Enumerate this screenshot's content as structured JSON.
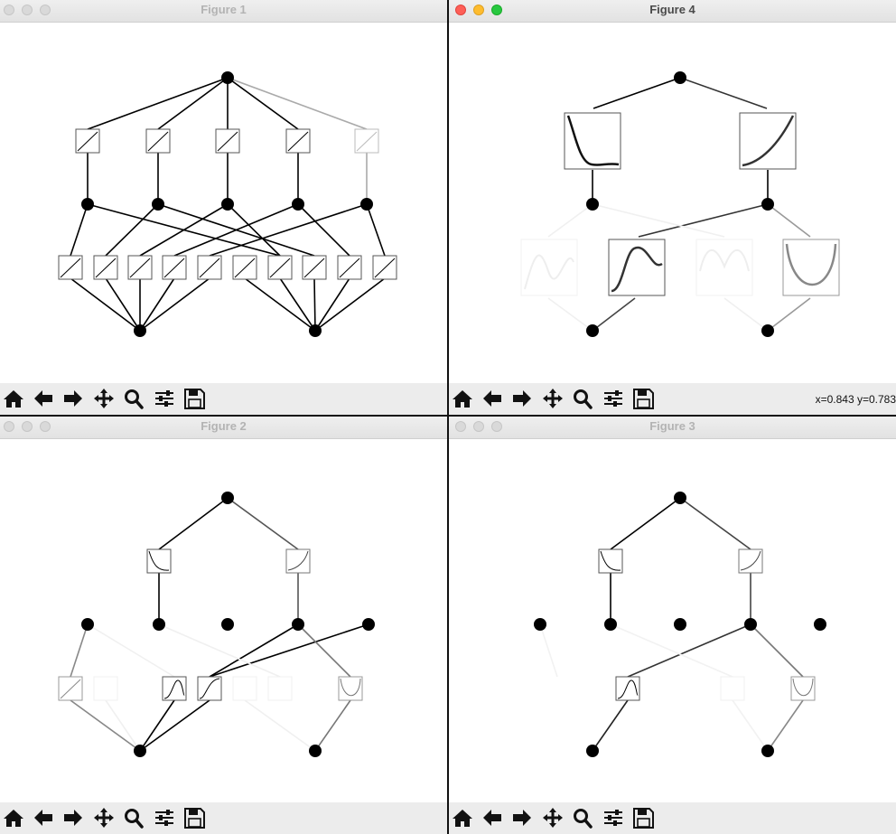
{
  "windows": [
    {
      "id": "fig1",
      "title": "Figure 1",
      "active": false,
      "coords": ""
    },
    {
      "id": "fig4",
      "title": "Figure 4",
      "active": true,
      "coords": "x=0.843 y=0.783"
    },
    {
      "id": "fig2",
      "title": "Figure 2",
      "active": false,
      "coords": ""
    },
    {
      "id": "fig3",
      "title": "Figure 3",
      "active": false,
      "coords": ""
    }
  ],
  "toolbar_buttons": [
    {
      "name": "home",
      "icon": "home-icon"
    },
    {
      "name": "back",
      "icon": "arrow-left-icon"
    },
    {
      "name": "forward",
      "icon": "arrow-right-icon"
    },
    {
      "name": "pan",
      "icon": "move-icon"
    },
    {
      "name": "zoom",
      "icon": "magnifier-icon"
    },
    {
      "name": "configure-subplots",
      "icon": "sliders-icon"
    },
    {
      "name": "save",
      "icon": "floppy-icon"
    }
  ]
}
